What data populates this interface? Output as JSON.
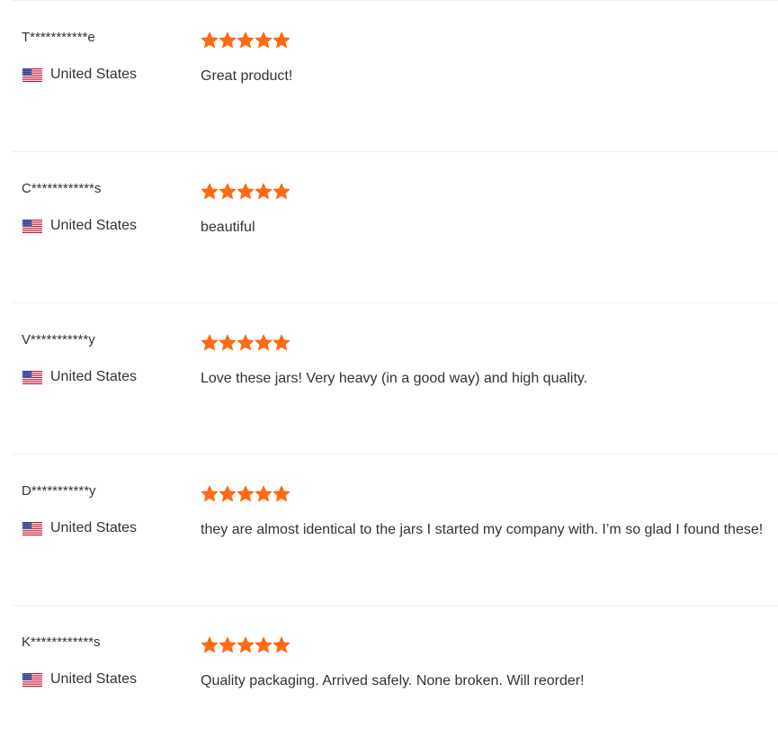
{
  "colors": {
    "star": "#ff6a13",
    "text": "#333333",
    "divider": "#efefef"
  },
  "icons": {
    "flag": "us-flag-icon",
    "star": "star-icon"
  },
  "reviews": [
    {
      "name": "T***********e",
      "country": "United States",
      "rating": 5,
      "text": "Great product!"
    },
    {
      "name": "C************s",
      "country": "United States",
      "rating": 5,
      "text": "beautiful"
    },
    {
      "name": "V***********y",
      "country": "United States",
      "rating": 5,
      "text": "Love these jars! Very heavy (in a good way) and high quality."
    },
    {
      "name": "D***********y",
      "country": "United States",
      "rating": 5,
      "text": "they are almost identical to the jars I started my company with. I’m so glad I found these!"
    },
    {
      "name": "K************s",
      "country": "United States",
      "rating": 5,
      "text": "Quality packaging. Arrived safely. None broken. Will reorder!"
    }
  ]
}
